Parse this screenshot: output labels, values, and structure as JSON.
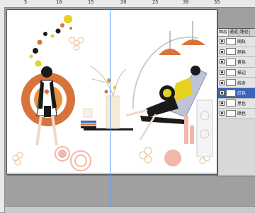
{
  "ruler": {
    "top_labels": [
      "5",
      "10",
      "15",
      "20",
      "25",
      "30",
      "35"
    ]
  },
  "layers_panel": {
    "tabs": [
      "图层",
      "通道",
      "路径"
    ],
    "layers": [
      {
        "name": "随轨",
        "selected": false
      },
      {
        "name": "颜色",
        "selected": false
      },
      {
        "name": "黄色",
        "selected": false
      },
      {
        "name": "描边",
        "selected": false
      },
      {
        "name": "线条",
        "selected": false
      },
      {
        "name": "红色",
        "selected": true
      },
      {
        "name": "黑色",
        "selected": false
      },
      {
        "name": "暗色",
        "selected": false
      }
    ]
  },
  "colors": {
    "accent_orange": "#d8733a",
    "pink": "#f0b8a8",
    "yellow": "#e8d020",
    "dark": "#1a1a1a",
    "selection_blue": "#3a66b8"
  }
}
